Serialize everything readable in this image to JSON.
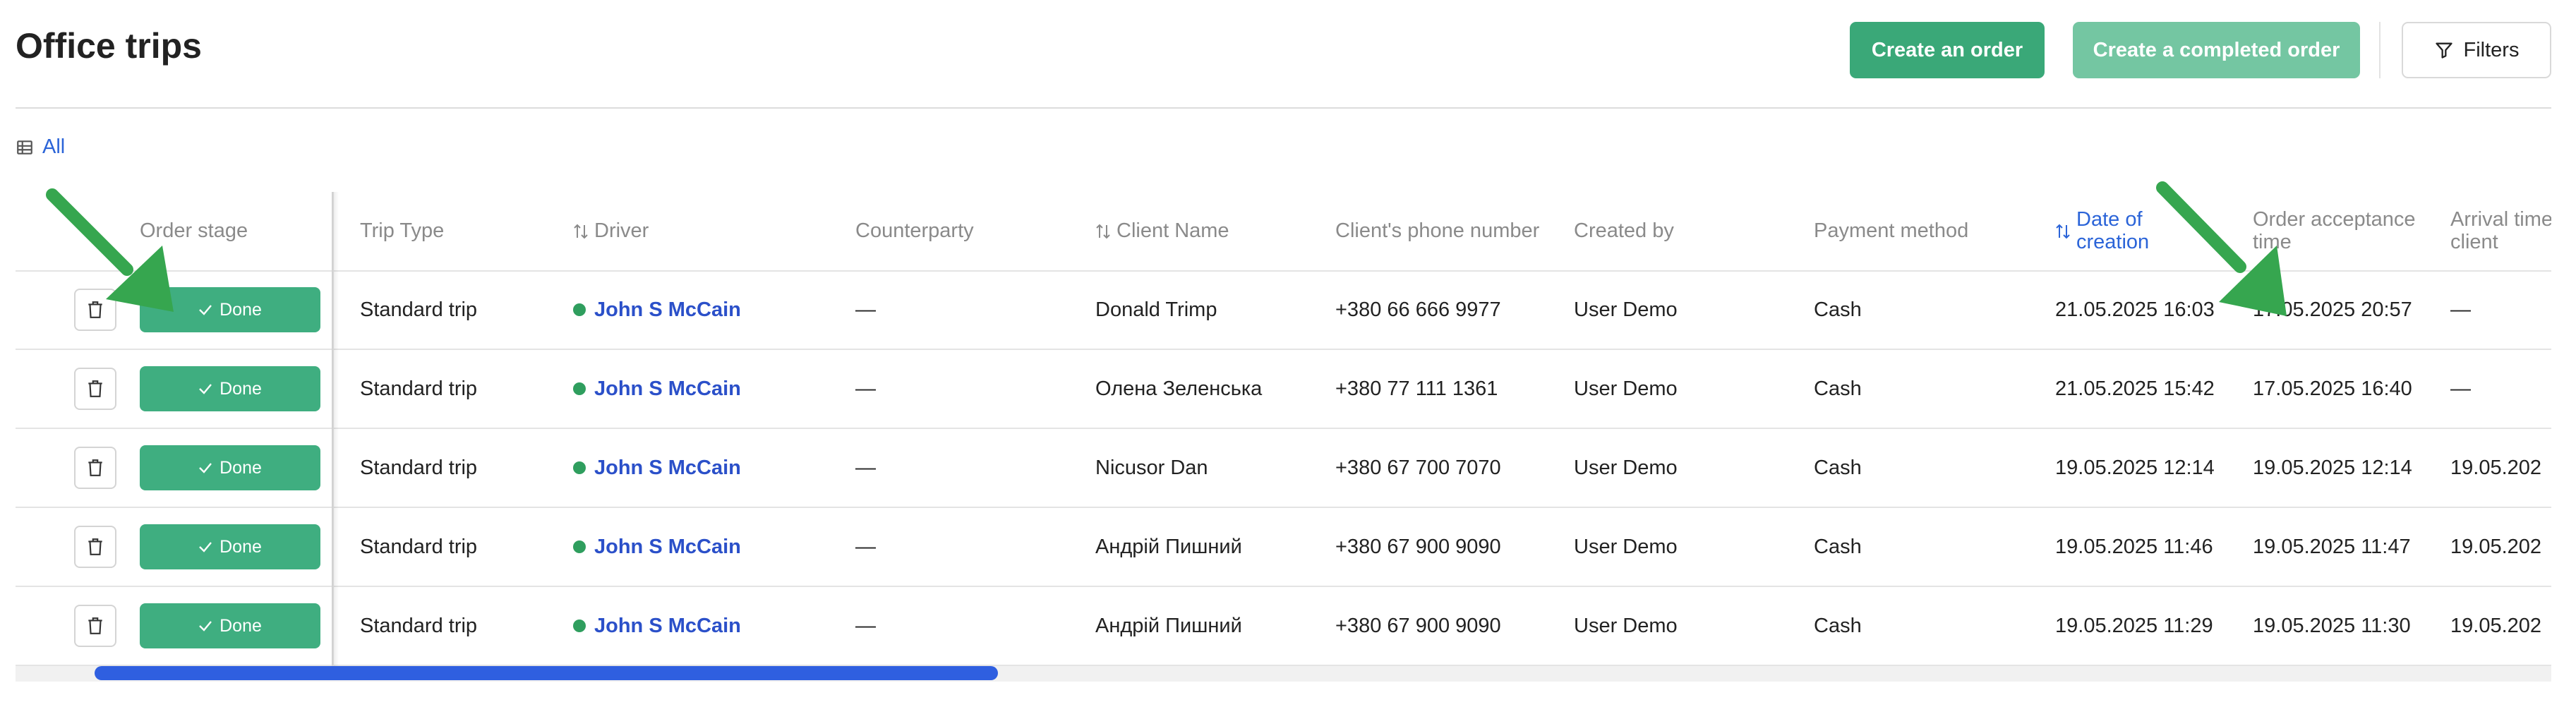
{
  "page": {
    "title": "Office trips"
  },
  "toolbar": {
    "create_order": "Create an order",
    "create_completed_order": "Create a completed order",
    "filters": "Filters"
  },
  "views": {
    "all": "All"
  },
  "table": {
    "headers": {
      "order_stage": "Order stage",
      "trip_type": "Trip Type",
      "driver": "Driver",
      "counterparty": "Counterparty",
      "client_name": "Client Name",
      "phone": "Client's phone number",
      "created_by": "Created by",
      "payment_method": "Payment method",
      "date_of_creation_1": "Date of",
      "date_of_creation_2": "creation",
      "acceptance_1": "Order acceptance",
      "acceptance_2": "time",
      "arrival_1": "Arrival time",
      "arrival_2": "client"
    },
    "rows": [
      {
        "stage": "Done",
        "trip_type": "Standard trip",
        "driver": "John S McCain",
        "counterparty": "—",
        "client": "Donald Trimp",
        "phone": "+380 66 666 9977",
        "created_by": "User Demo",
        "payment": "Cash",
        "created": "21.05.2025 16:03",
        "accepted": "17.05.2025 20:57",
        "arrival": "—"
      },
      {
        "stage": "Done",
        "trip_type": "Standard trip",
        "driver": "John S McCain",
        "counterparty": "—",
        "client": "Олена Зеленська",
        "phone": "+380 77 111 1361",
        "created_by": "User Demo",
        "payment": "Cash",
        "created": "21.05.2025 15:42",
        "accepted": "17.05.2025 16:40",
        "arrival": "—"
      },
      {
        "stage": "Done",
        "trip_type": "Standard trip",
        "driver": "John S McCain",
        "counterparty": "—",
        "client": "Nicusor Dan",
        "phone": "+380 67 700 7070",
        "created_by": "User Demo",
        "payment": "Cash",
        "created": "19.05.2025 12:14",
        "accepted": "19.05.2025 12:14",
        "arrival": "19.05.202"
      },
      {
        "stage": "Done",
        "trip_type": "Standard trip",
        "driver": "John S McCain",
        "counterparty": "—",
        "client": "Андрій Пишний",
        "phone": "+380 67 900 9090",
        "created_by": "User Demo",
        "payment": "Cash",
        "created": "19.05.2025 11:46",
        "accepted": "19.05.2025 11:47",
        "arrival": "19.05.202"
      },
      {
        "stage": "Done",
        "trip_type": "Standard trip",
        "driver": "John S McCain",
        "counterparty": "—",
        "client": "Андрій Пишний",
        "phone": "+380 67 900 9090",
        "created_by": "User Demo",
        "payment": "Cash",
        "created": "19.05.2025 11:29",
        "accepted": "19.05.2025 11:30",
        "arrival": "19.05.202"
      }
    ]
  },
  "icons": {
    "filter": "filter-icon",
    "table_view": "table-view-icon",
    "sort": "sort-icon",
    "trash": "trash-icon",
    "check": "check-icon"
  },
  "colors": {
    "accent_green": "#3aa878",
    "link_blue": "#2b64d8",
    "annotation_arrow": "#36a64f",
    "scrollbar": "#2f5fe0"
  }
}
